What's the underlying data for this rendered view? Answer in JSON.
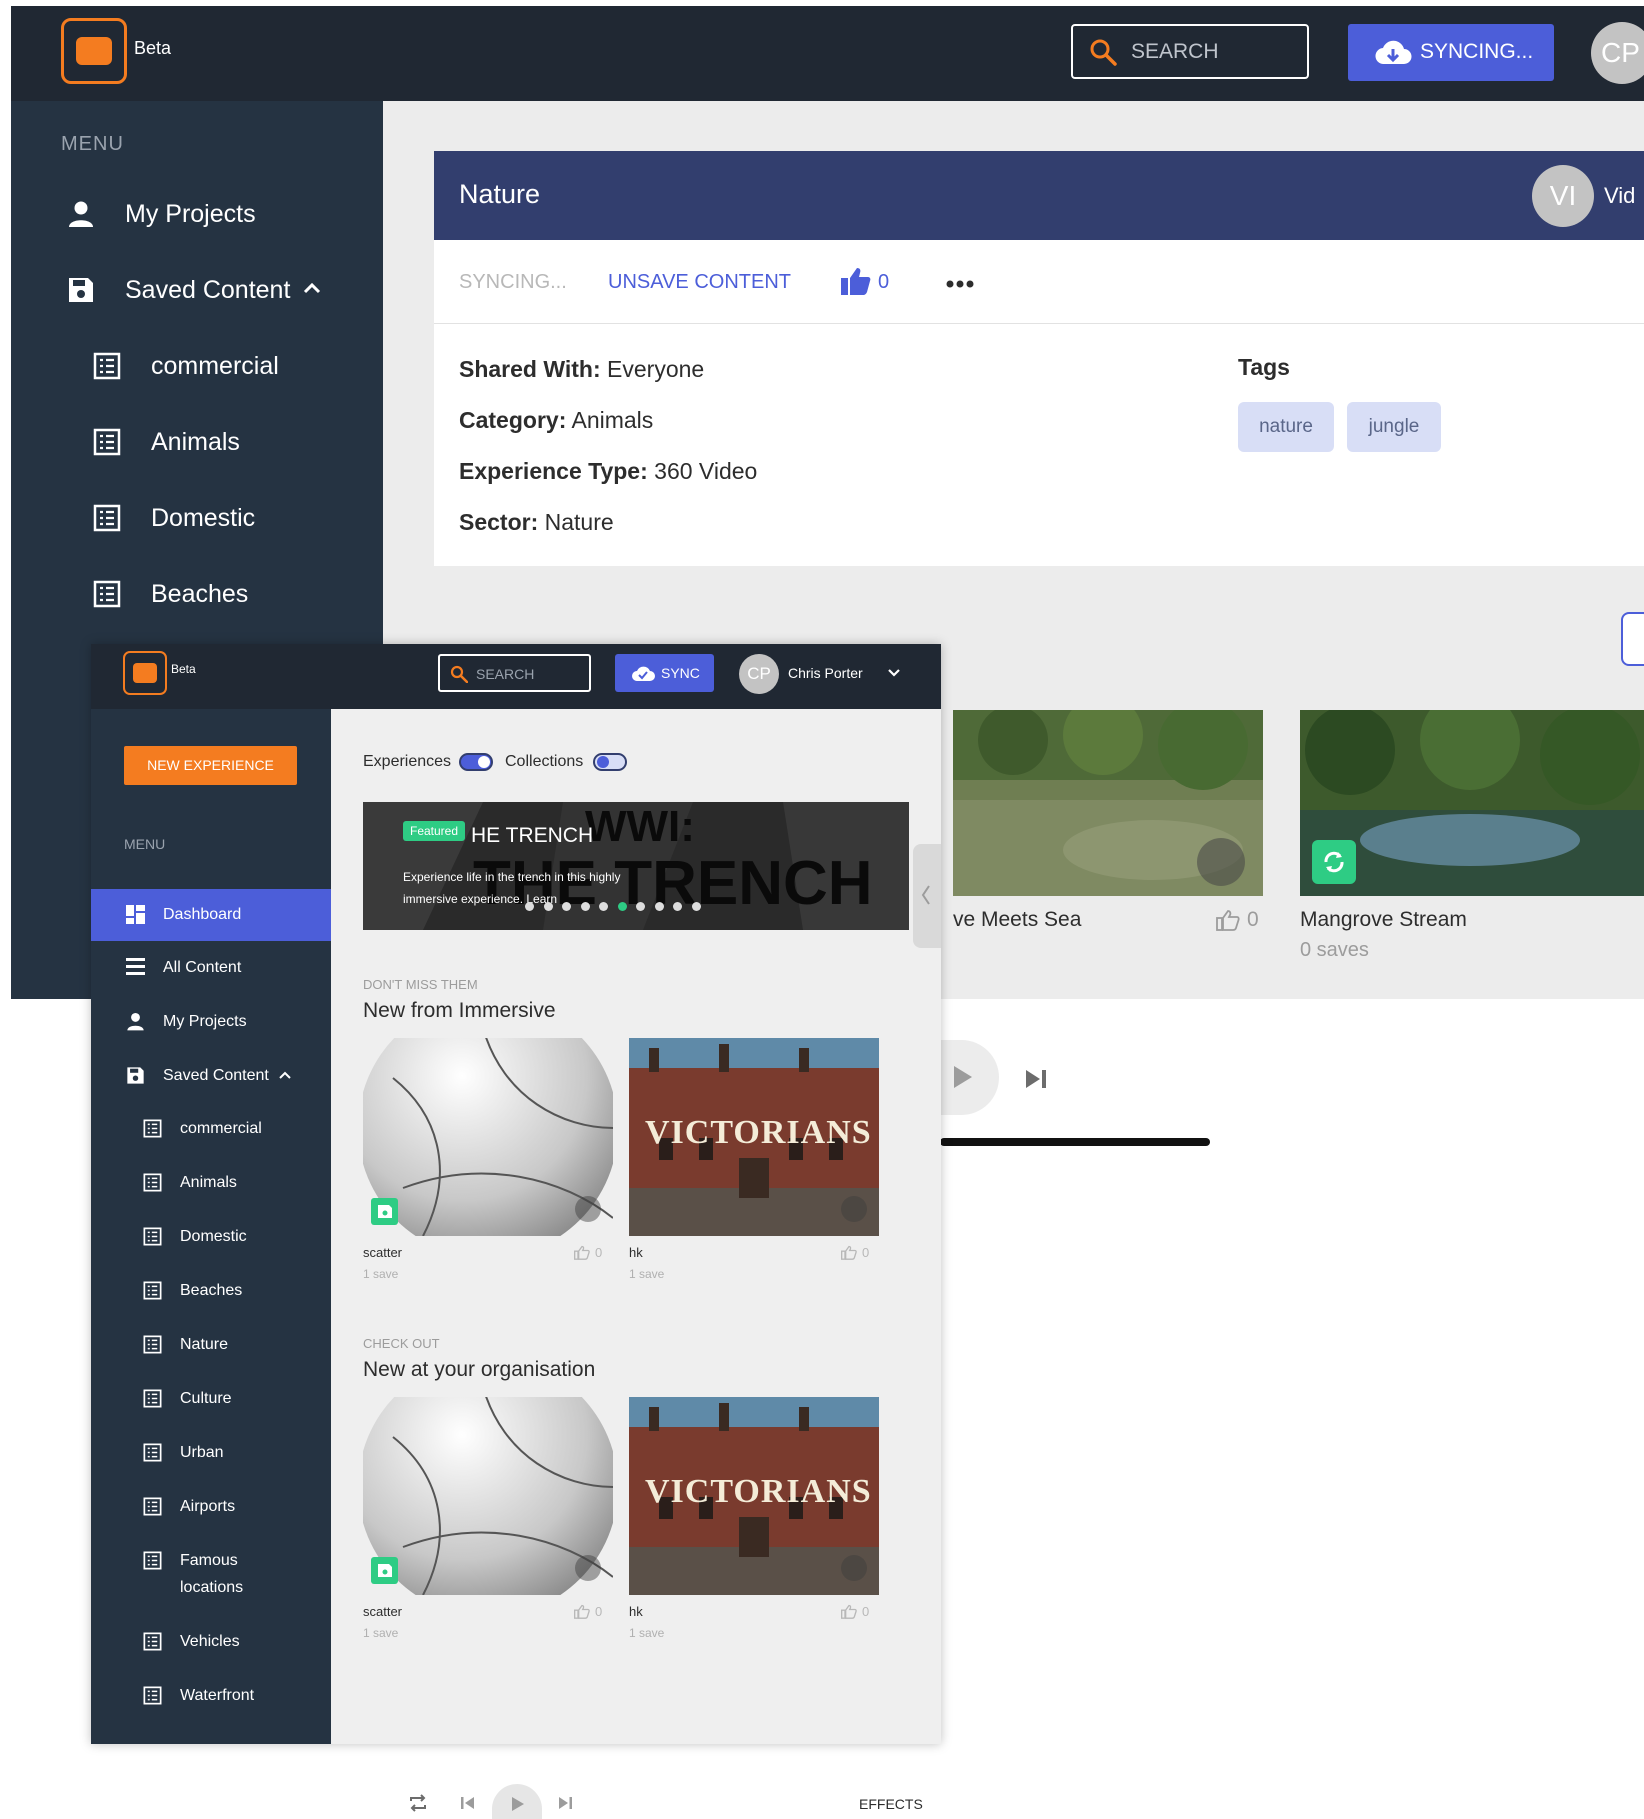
{
  "back": {
    "header": {
      "beta": "Beta",
      "search_placeholder": "SEARCH",
      "sync_label": "SYNCING...",
      "avatar_initials": "CP"
    },
    "sidebar": {
      "menu_label": "MENU",
      "items": [
        {
          "label": "My Projects",
          "icon": "user-icon"
        },
        {
          "label": "Saved Content",
          "icon": "save-icon"
        },
        {
          "label": "commercial",
          "icon": "list-icon"
        },
        {
          "label": "Animals",
          "icon": "list-icon"
        },
        {
          "label": "Domestic",
          "icon": "list-icon"
        },
        {
          "label": "Beaches",
          "icon": "list-icon"
        }
      ]
    },
    "card": {
      "title": "Nature",
      "owner_initials": "VI",
      "owner_name": "Vid",
      "syncing": "SYNCING...",
      "unsave": "UNSAVE CONTENT",
      "likes": "0",
      "shared_with_label": "Shared With:",
      "shared_with": "Everyone",
      "category_label": "Category:",
      "category": "Animals",
      "experience_type_label": "Experience Type:",
      "experience_type": "360 Video",
      "sector_label": "Sector:",
      "sector": "Nature",
      "tags_label": "Tags",
      "tags": [
        "nature",
        "jungle"
      ]
    },
    "thumbs": [
      {
        "title": "ve Meets Sea",
        "likes": "0"
      },
      {
        "title": "Mangrove Stream",
        "saves": "0 saves"
      }
    ]
  },
  "front": {
    "header": {
      "beta": "Beta",
      "search_placeholder": "SEARCH",
      "sync_label": "SYNC",
      "avatar_initials": "CP",
      "user_name": "Chris Porter"
    },
    "sidebar": {
      "new_experience": "NEW EXPERIENCE",
      "menu_label": "MENU",
      "items": [
        {
          "label": "Dashboard",
          "icon": "dashboard-icon",
          "active": true
        },
        {
          "label": "All Content",
          "icon": "menu-icon"
        },
        {
          "label": "My Projects",
          "icon": "user-icon"
        },
        {
          "label": "Saved Content",
          "icon": "save-icon"
        },
        {
          "label": "commercial",
          "icon": "list-icon"
        },
        {
          "label": "Animals",
          "icon": "list-icon"
        },
        {
          "label": "Domestic",
          "icon": "list-icon"
        },
        {
          "label": "Beaches",
          "icon": "list-icon"
        },
        {
          "label": "Nature",
          "icon": "list-icon"
        },
        {
          "label": "Culture",
          "icon": "list-icon"
        },
        {
          "label": "Urban",
          "icon": "list-icon"
        },
        {
          "label": "Airports",
          "icon": "list-icon"
        },
        {
          "label": "Famous",
          "label2": "locations",
          "icon": "list-icon"
        },
        {
          "label": "Vehicles",
          "icon": "list-icon"
        },
        {
          "label": "Waterfront",
          "icon": "list-icon"
        }
      ]
    },
    "toggles": {
      "experiences": "Experiences",
      "collections": "Collections"
    },
    "banner": {
      "badge": "Featured",
      "title": "HE TRENCH",
      "bg_text_1": "WWI:",
      "bg_text_2": "THE TRENCH",
      "description": "Experience life in the trench in this highly immersive experience. Learn",
      "dots": 10,
      "active_dot": 5
    },
    "sections": [
      {
        "pre": "DON'T MISS THEM",
        "title": "New from Immersive",
        "tiles": [
          {
            "name": "scatter",
            "saves": "1 save",
            "likes": "0",
            "image": "volleyball"
          },
          {
            "name": "hk",
            "saves": "1 save",
            "likes": "0",
            "image": "victorians",
            "image_text": "VICTORIANS"
          }
        ]
      },
      {
        "pre": "CHECK OUT",
        "title": "New at your organisation",
        "tiles": [
          {
            "name": "scatter",
            "saves": "1 save",
            "likes": "0",
            "image": "volleyball"
          },
          {
            "name": "hk",
            "saves": "1 save",
            "likes": "0",
            "image": "victorians",
            "image_text": "VICTORIANS"
          }
        ]
      }
    ]
  },
  "player": {
    "effects": "EFFECTS"
  },
  "colors": {
    "topbar": "#202833",
    "sidebar": "#253342",
    "accent": "#4c5ed9",
    "brand_orange": "#f47c20",
    "green": "#2ecc84",
    "card_header": "#323e6e"
  }
}
